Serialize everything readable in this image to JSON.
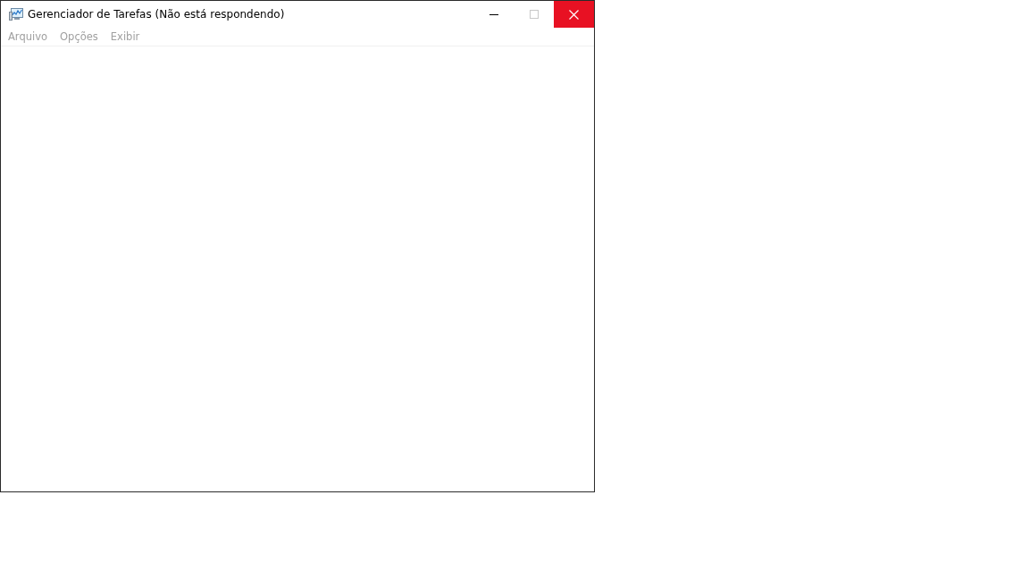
{
  "window": {
    "title": "Gerenciador de Tarefas (Não está respondendo)"
  },
  "caption_buttons": [
    {
      "kind": "minimize",
      "disabled": false,
      "hovered": false
    },
    {
      "kind": "maximize",
      "disabled": true,
      "hovered": false
    },
    {
      "kind": "close",
      "disabled": false,
      "hovered": true
    }
  ],
  "menu": [
    {
      "label": "Arquivo",
      "disabled": true
    },
    {
      "label": "Opções",
      "disabled": true
    },
    {
      "label": "Exibir",
      "disabled": true
    }
  ]
}
